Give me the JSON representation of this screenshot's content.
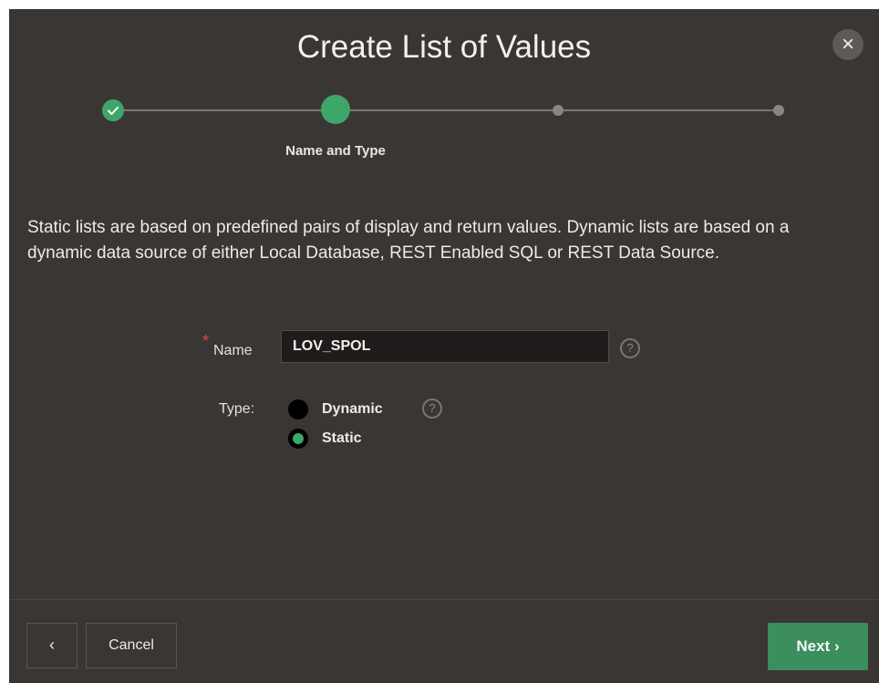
{
  "dialog": {
    "title": "Create List of Values",
    "close_symbol": "×"
  },
  "wizard": {
    "current_step_label": "Name and Type",
    "steps_total": 4,
    "step_states": [
      "done",
      "current",
      "future",
      "future"
    ],
    "done_icon": "check-icon"
  },
  "description": "Static lists are based on predefined pairs of display and return values. Dynamic lists are based on a dynamic data source of either Local Database, REST Enabled SQL or REST Data Source.",
  "form": {
    "name_required_mark": "*",
    "name_label": "Name",
    "name_value": "LOV_SPOL",
    "help_symbol": "?",
    "type_label": "Type:",
    "type_options": [
      {
        "label": "Dynamic",
        "selected": false
      },
      {
        "label": "Static",
        "selected": true
      }
    ]
  },
  "footer": {
    "prev_symbol": "‹",
    "cancel_label": "Cancel",
    "next_label": "Next ›"
  },
  "colors": {
    "dialog_bg": "#3a3634",
    "accent_green": "#3fa66a",
    "next_button_bg": "#3c8e5d",
    "required_red": "#e5484d"
  }
}
